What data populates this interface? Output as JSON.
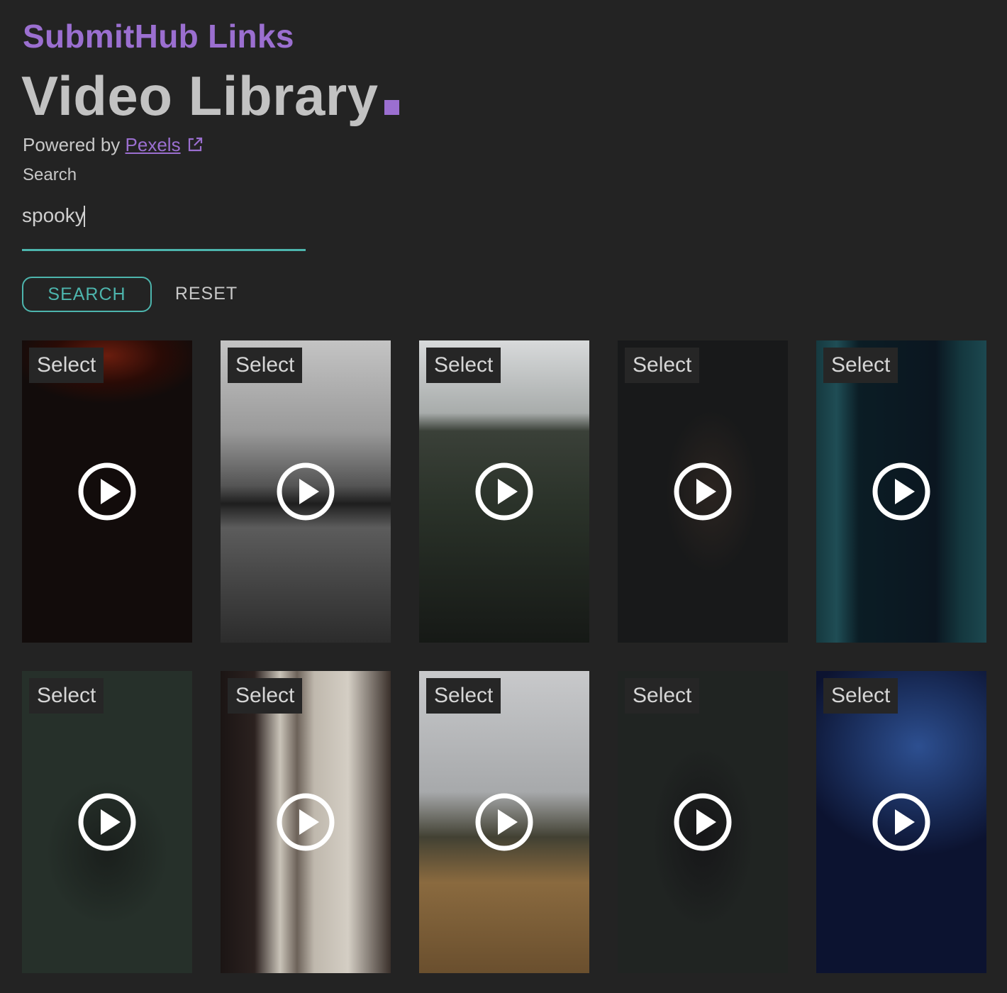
{
  "header": {
    "brand": "SubmitHub Links",
    "title": "Video Library"
  },
  "powered": {
    "prefix": "Powered by ",
    "link_label": "Pexels",
    "link_icon": "external-link-icon"
  },
  "search": {
    "label": "Search",
    "value": "spooky",
    "search_button": "SEARCH",
    "reset_button": "RESET"
  },
  "colors": {
    "accent_purple": "#9b6fd0",
    "accent_teal": "#4db5ad",
    "background": "#232323"
  },
  "videos": [
    {
      "select_label": "Select",
      "icon": "play-icon"
    },
    {
      "select_label": "Select",
      "icon": "play-icon"
    },
    {
      "select_label": "Select",
      "icon": "play-icon"
    },
    {
      "select_label": "Select",
      "icon": "play-icon"
    },
    {
      "select_label": "Select",
      "icon": "play-icon"
    },
    {
      "select_label": "Select",
      "icon": "play-icon"
    },
    {
      "select_label": "Select",
      "icon": "play-icon"
    },
    {
      "select_label": "Select",
      "icon": "play-icon"
    },
    {
      "select_label": "Select",
      "icon": "play-icon"
    },
    {
      "select_label": "Select",
      "icon": "play-icon"
    }
  ]
}
